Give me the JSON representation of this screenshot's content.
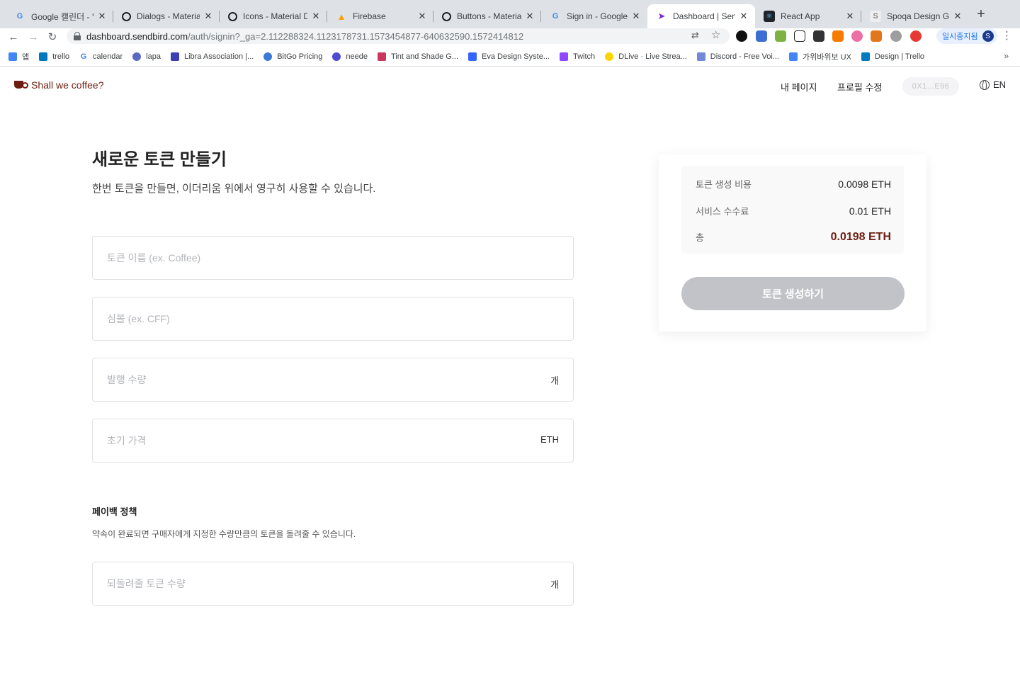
{
  "browser": {
    "tabs": [
      {
        "label": "Google 캘린더 - 일정",
        "icon": "google-icon",
        "color": "#4285f4"
      },
      {
        "label": "Dialogs - Material D",
        "icon": "material-icon",
        "color": "#202124"
      },
      {
        "label": "Icons - Material Des",
        "icon": "material-icon",
        "color": "#202124"
      },
      {
        "label": "Firebase",
        "icon": "firebase-icon",
        "color": "#ffa000"
      },
      {
        "label": "Buttons - Material D",
        "icon": "material-icon",
        "color": "#202124"
      },
      {
        "label": "Sign in - Google Ac",
        "icon": "google-icon",
        "color": "#4285f4"
      },
      {
        "label": "Dashboard | SendBi",
        "icon": "sendbird-icon",
        "color": "#742ddd"
      },
      {
        "label": "React App",
        "icon": "react-icon",
        "color": "#20232a"
      },
      {
        "label": "Spoqa Design Guide",
        "icon": "spoqa-icon",
        "color": "#888888"
      }
    ],
    "url_host": "dashboard.sendbird.com",
    "url_path": "/auth/signin?_ga=2.112288324.1123178731.1573454877-640632590.1572414812",
    "profile_label": "일시중지됨",
    "profile_initial": "S",
    "bookmarks": [
      {
        "label": "앱",
        "icon": "apps-grid-icon",
        "color": "#4285f4"
      },
      {
        "label": "trello",
        "icon": "trello-icon",
        "color": "#0079bf"
      },
      {
        "label": "calendar",
        "icon": "google-icon",
        "color": "#4285f4"
      },
      {
        "label": "lapa",
        "icon": "lapa-icon",
        "color": "#5c6bc0"
      },
      {
        "label": "Libra Association |...",
        "icon": "libra-icon",
        "color": "#3f3fb5"
      },
      {
        "label": "BitGo Pricing",
        "icon": "bitgo-icon",
        "color": "#3a7bd5"
      },
      {
        "label": "neede",
        "icon": "neede-icon",
        "color": "#4b4bd6"
      },
      {
        "label": "Tint and Shade G...",
        "icon": "tint-icon",
        "color": "#c9385c"
      },
      {
        "label": "Eva Design Syste...",
        "icon": "eva-icon",
        "color": "#3366ff"
      },
      {
        "label": "Twitch",
        "icon": "twitch-icon",
        "color": "#9146ff"
      },
      {
        "label": "DLive · Live Strea...",
        "icon": "dlive-icon",
        "color": "#ffd300"
      },
      {
        "label": "Discord - Free Voi...",
        "icon": "discord-icon",
        "color": "#7289da"
      },
      {
        "label": "가위바위보 UX",
        "icon": "docs-icon",
        "color": "#4285f4"
      },
      {
        "label": "Design | Trello",
        "icon": "trello-icon",
        "color": "#0079bf"
      }
    ],
    "bookmarks_more": "»"
  },
  "header": {
    "logo_text": "Shall we coffee?",
    "nav": [
      "내 페이지",
      "프로필 수정"
    ],
    "wallet": "0X1...E96",
    "lang": "EN"
  },
  "main": {
    "title": "새로운 토큰 만들기",
    "subtitle": "한번 토큰을 만들면, 이더리움 위에서 영구히 사용할 수 있습니다.",
    "fields": {
      "name": {
        "placeholder": "토큰 이름 (ex. Coffee)"
      },
      "symbol": {
        "placeholder": "심볼 (ex. CFF)"
      },
      "supply": {
        "placeholder": "발행 수량",
        "unit": "개"
      },
      "price": {
        "placeholder": "초기 가격",
        "unit": "ETH"
      },
      "payback": {
        "placeholder": "되돌려줄 토큰 수량",
        "unit": "개"
      }
    },
    "payback_title": "페이백 정책",
    "payback_desc": "약속이 완료되면 구매자에게 지정한 수량만큼의 토큰을 돌려줄 수 있습니다."
  },
  "summary": {
    "rows": [
      {
        "label": "토큰 생성 비용",
        "value": "0.0098 ETH"
      },
      {
        "label": "서비스 수수료",
        "value": "0.01 ETH"
      },
      {
        "label": "총",
        "value": "0.0198 ETH"
      }
    ],
    "button": "토큰 생성하기"
  },
  "colors": {
    "brand": "#6b1e0f",
    "disabled_button": "#c2c3c8"
  }
}
